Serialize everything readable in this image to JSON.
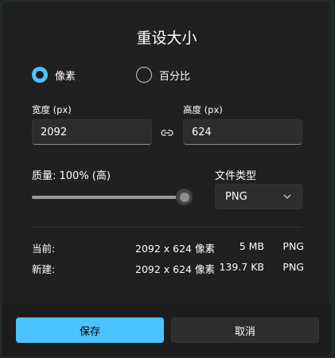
{
  "dialog": {
    "title": "重设大小"
  },
  "mode": {
    "options": [
      {
        "label": "像素",
        "selected": true
      },
      {
        "label": "百分比",
        "selected": false
      }
    ]
  },
  "width": {
    "label": "宽度 (px)",
    "value": "2092"
  },
  "height": {
    "label": "高度 (px)",
    "value": "624"
  },
  "quality": {
    "label": "质量: 100% (高)",
    "value_percent": 100
  },
  "file_type": {
    "label": "文件类型",
    "selected": "PNG"
  },
  "summary": {
    "current": {
      "label": "当前:",
      "dimensions": "2092 x 624 像素",
      "size": "5 MB",
      "format": "PNG"
    },
    "new": {
      "label": "新建:",
      "dimensions": "2092 x 624 像素",
      "size": "139.7 KB",
      "format": "PNG"
    }
  },
  "buttons": {
    "save": "保存",
    "cancel": "取消"
  },
  "colors": {
    "accent": "#4cc2ff",
    "background": "#202020",
    "input": "#2d2d2d"
  },
  "icons": {
    "link": "link-icon",
    "dropdown": "chevron-down-icon"
  }
}
